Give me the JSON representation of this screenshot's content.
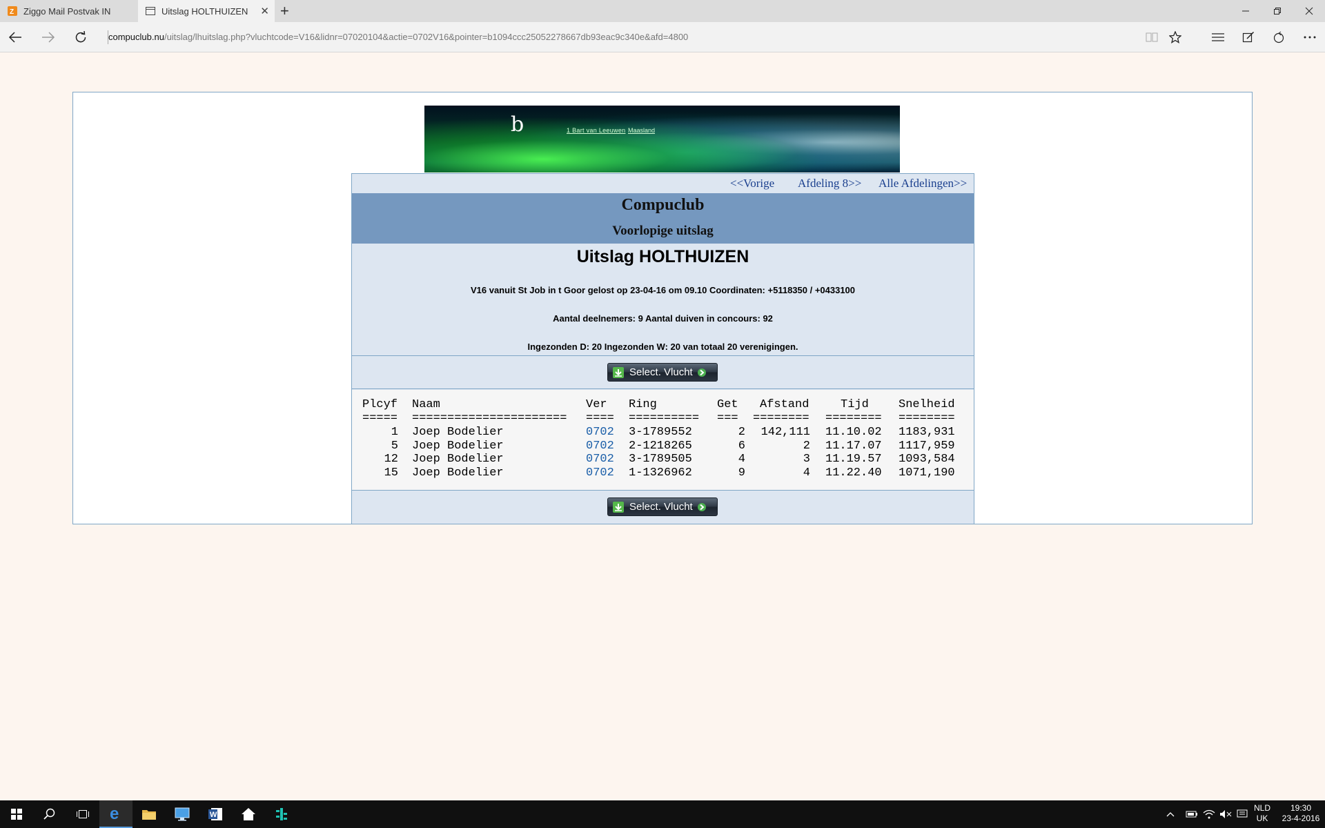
{
  "browser": {
    "tabs": [
      {
        "label": "Ziggo Mail Postvak IN",
        "active": false
      },
      {
        "label": "Uitslag HOLTHUIZEN",
        "active": true
      }
    ],
    "url_host": "compuclub.nu",
    "url_path": "/uitslag/lhuitslag.php?vluchtcode=V16&lidnr=07020104&actie=0702V16&pointer=b1094ccc25052278667db93eac9c340e&afd=4800",
    "new_tab_label": "+"
  },
  "banner": {
    "logo_letter": "b",
    "link1": "1 Bart van Leeuwen",
    "link2": "Maasland"
  },
  "nav": {
    "prev": "<<Vorige",
    "afdeling": "Afdeling 8>>",
    "alle": "Alle Afdelingen>>"
  },
  "header": {
    "club": "Compuclub",
    "subtitle": "Voorlopige uitslag"
  },
  "result": {
    "title": "Uitslag HOLTHUIZEN",
    "line1": "V16 vanuit St Job in t Goor gelost op 23-04-16 om 09.10 Coordinaten: +5118350 / +0433100",
    "line2": "Aantal deelnemers: 9 Aantal duiven in concours: 92",
    "line3": "Ingezonden D: 20 Ingezonden W: 20 van totaal 20 verenigingen."
  },
  "button_label": "Select. Vlucht",
  "table": {
    "headers": [
      "Plcyf",
      "Naam",
      "Ver",
      "Ring",
      "Get",
      "Afstand",
      "Tijd",
      "Snelheid"
    ],
    "separators": [
      "=====",
      "======================",
      "====",
      "==========",
      "===",
      "========",
      "========",
      "========"
    ],
    "rows": [
      {
        "plcyf": "1",
        "naam": "Joep Bodelier",
        "ver": "0702",
        "ring": "3-1789552",
        "get": "2",
        "afstand": "142,111",
        "tijd": "11.10.02",
        "snelheid": "1183,931"
      },
      {
        "plcyf": "5",
        "naam": "Joep Bodelier",
        "ver": "0702",
        "ring": "2-1218265",
        "get": "6",
        "afstand": "2",
        "tijd": "11.17.07",
        "snelheid": "1117,959"
      },
      {
        "plcyf": "12",
        "naam": "Joep Bodelier",
        "ver": "0702",
        "ring": "3-1789505",
        "get": "4",
        "afstand": "3",
        "tijd": "11.19.57",
        "snelheid": "1093,584"
      },
      {
        "plcyf": "15",
        "naam": "Joep Bodelier",
        "ver": "0702",
        "ring": "1-1326962",
        "get": "9",
        "afstand": "4",
        "tijd": "11.22.40",
        "snelheid": "1071,190"
      }
    ]
  },
  "taskbar": {
    "lang_top": "NLD",
    "lang_bottom": "UK",
    "time": "19:30",
    "date": "23-4-2016"
  }
}
